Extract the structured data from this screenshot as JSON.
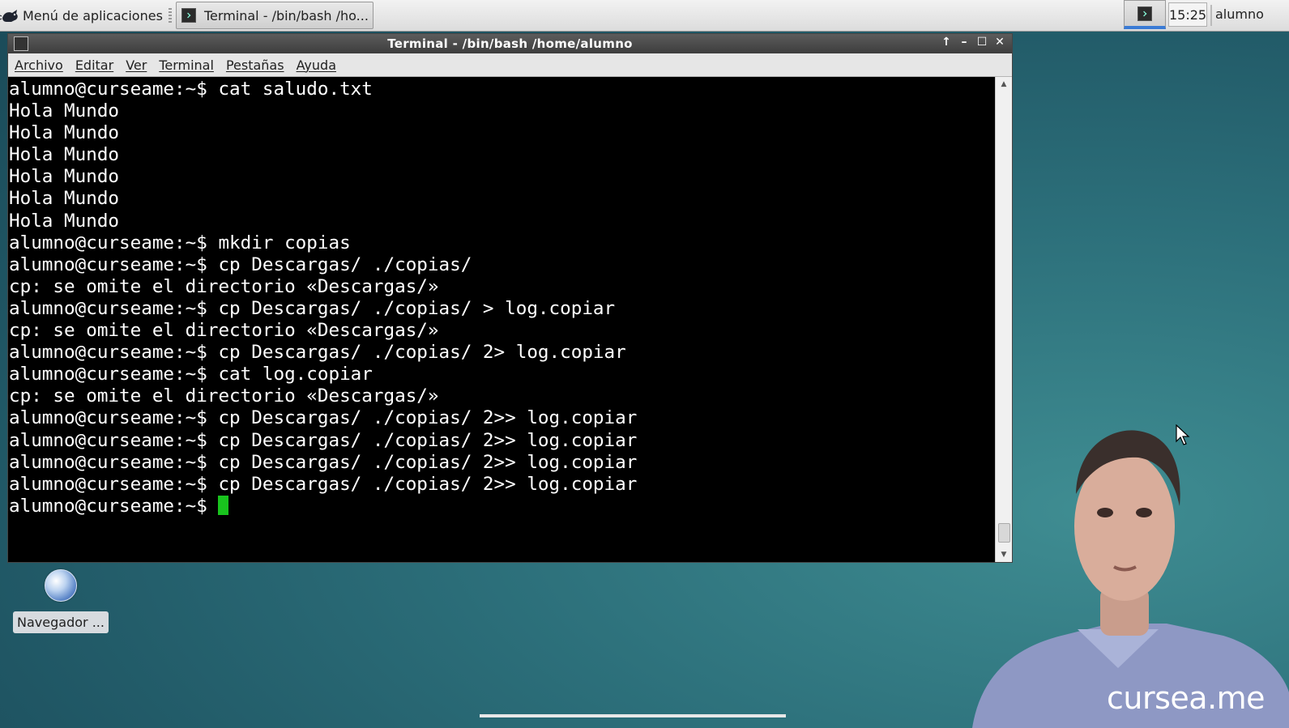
{
  "panel": {
    "app_menu_label": "Menú de aplicaciones",
    "task_button_label": "Terminal - /bin/bash  /ho...",
    "clock": "15:25",
    "user": "alumno"
  },
  "window": {
    "title": "Terminal - /bin/bash  /home/alumno",
    "controls": [
      "↑",
      "–",
      "☐",
      "✕"
    ],
    "menu": [
      "Archivo",
      "Editar",
      "Ver",
      "Terminal",
      "Pestañas",
      "Ayuda"
    ]
  },
  "terminal": {
    "lines": [
      "alumno@curseame:~$ cat saludo.txt",
      "Hola Mundo",
      "Hola Mundo",
      "Hola Mundo",
      "Hola Mundo",
      "Hola Mundo",
      "Hola Mundo",
      "alumno@curseame:~$ mkdir copias",
      "alumno@curseame:~$ cp Descargas/ ./copias/",
      "cp: se omite el directorio «Descargas/»",
      "alumno@curseame:~$ cp Descargas/ ./copias/ > log.copiar",
      "cp: se omite el directorio «Descargas/»",
      "alumno@curseame:~$ cp Descargas/ ./copias/ 2> log.copiar",
      "alumno@curseame:~$ cat log.copiar",
      "cp: se omite el directorio «Descargas/»",
      "alumno@curseame:~$ cp Descargas/ ./copias/ 2>> log.copiar",
      "alumno@curseame:~$ cp Descargas/ ./copias/ 2>> log.copiar",
      "alumno@curseame:~$ cp Descargas/ ./copias/ 2>> log.copiar",
      "alumno@curseame:~$ cp Descargas/ ./copias/ 2>> log.copiar"
    ],
    "prompt": "alumno@curseame:~$ ",
    "cursor_color": "#19c31e"
  },
  "desktop": {
    "icon_label": "Navegador ...",
    "icon_name": "globe-icon"
  },
  "overlay": {
    "watermark": "cursea.me"
  }
}
